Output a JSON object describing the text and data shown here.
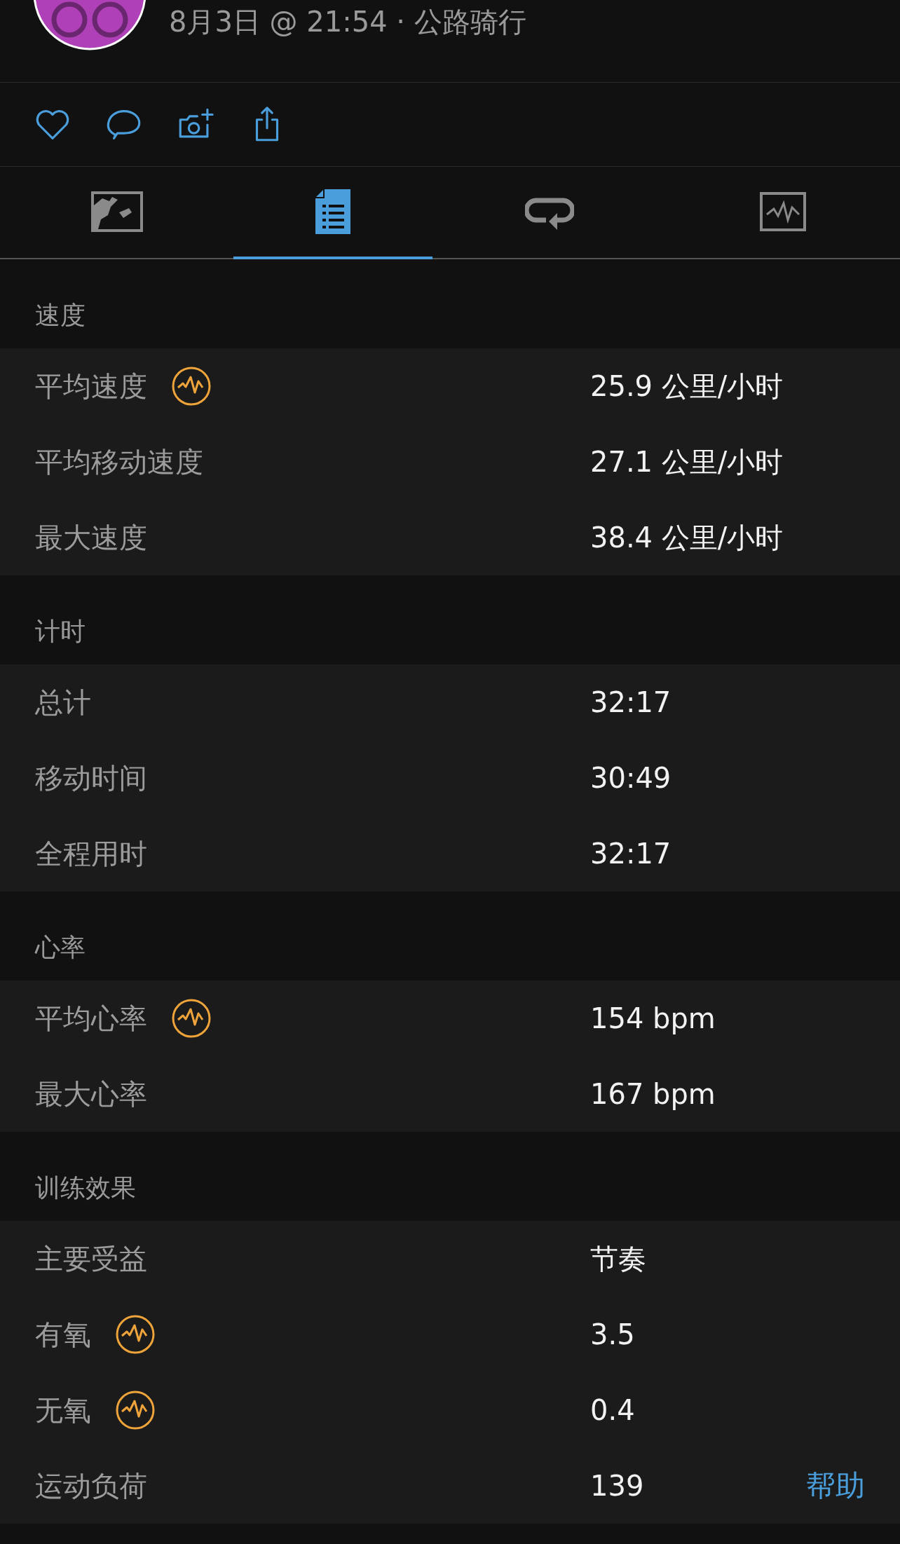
{
  "header": {
    "subtitle": "8月3日 @ 21:54 · 公路骑行"
  },
  "actions": [
    {
      "kind": "like"
    },
    {
      "kind": "comment"
    },
    {
      "kind": "photo"
    },
    {
      "kind": "share"
    }
  ],
  "tabs": [
    {
      "kind": "map",
      "selected": false
    },
    {
      "kind": "stats",
      "selected": true
    },
    {
      "kind": "laps",
      "selected": false
    },
    {
      "kind": "charts",
      "selected": false
    }
  ],
  "sections": [
    {
      "title": "速度",
      "rows": [
        {
          "label": "平均速度",
          "insight": true,
          "value": "25.9 公里/小时"
        },
        {
          "label": "平均移动速度",
          "insight": false,
          "value": "27.1 公里/小时"
        },
        {
          "label": "最大速度",
          "insight": false,
          "value": "38.4 公里/小时"
        }
      ]
    },
    {
      "title": "计时",
      "rows": [
        {
          "label": "总计",
          "insight": false,
          "value": "32:17"
        },
        {
          "label": "移动时间",
          "insight": false,
          "value": "30:49"
        },
        {
          "label": "全程用时",
          "insight": false,
          "value": "32:17"
        }
      ]
    },
    {
      "title": "心率",
      "rows": [
        {
          "label": "平均心率",
          "insight": true,
          "value": "154 bpm"
        },
        {
          "label": "最大心率",
          "insight": false,
          "value": "167 bpm"
        }
      ]
    },
    {
      "title": "训练效果",
      "rows": [
        {
          "label": "主要受益",
          "insight": false,
          "value": "节奏"
        },
        {
          "label": "有氧",
          "insight": true,
          "value": "3.5"
        },
        {
          "label": "无氧",
          "insight": true,
          "value": "0.4"
        },
        {
          "label": "运动负荷",
          "insight": false,
          "value": "139",
          "link": "帮助"
        }
      ]
    }
  ]
}
